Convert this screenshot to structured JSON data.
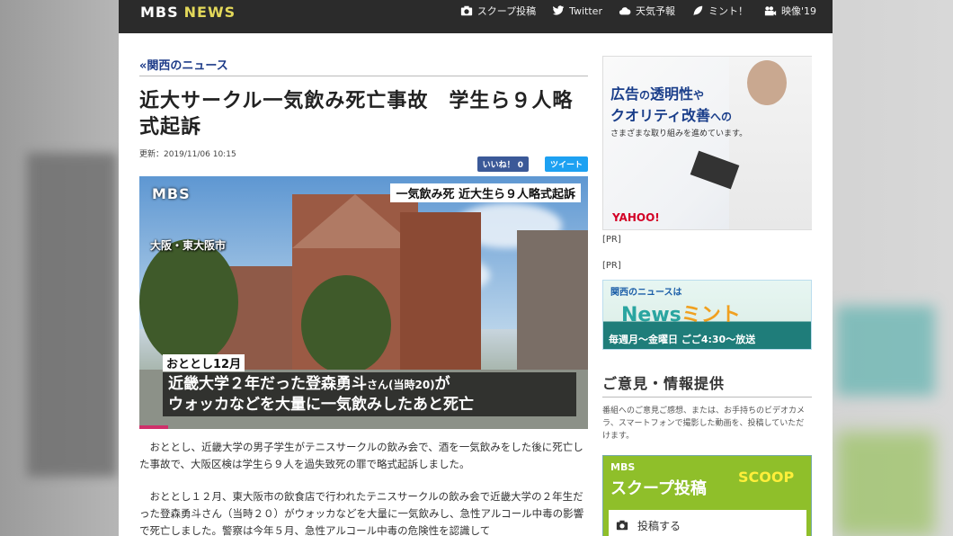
{
  "header": {
    "logo_mbs": "MBS",
    "logo_news": "NEWS",
    "nav": [
      {
        "label": "スクープ投稿",
        "icon": "camera-icon"
      },
      {
        "label": "Twitter",
        "icon": "twitter-icon"
      },
      {
        "label": "天気予報",
        "icon": "cloud-icon"
      },
      {
        "label": "ミント！",
        "icon": "leaf-icon"
      },
      {
        "label": "映像'19",
        "icon": "video-icon"
      }
    ]
  },
  "article": {
    "breadcrumb": "«関西のニュース",
    "title": "近大サークル一気飲み死亡事故　学生ら９人略式起訴",
    "updated": "更新：2019/11/06 10:15",
    "like_label": "いいね！ 0",
    "tweet_label": "ツイート",
    "video": {
      "logo": "MBS",
      "top_caption": "一気飲み死 近大生ら９人略式起訴",
      "place": "大阪・東大阪市",
      "when": "おととし12月",
      "subtitle_line1_a": "近畿大学２年だった登森勇斗",
      "subtitle_line1_b": "さん(当時20)",
      "subtitle_line1_c": "が",
      "subtitle_line2": "ウォッカなどを大量に一気飲みしたあと死亡"
    },
    "paragraphs": [
      "おととし、近畿大学の男子学生がテニスサークルの飲み会で、酒を一気飲みをした後に死亡した事故で、大阪区検は学生ら９人を過失致死の罪で略式起訴しました。",
      "おととし１２月、東大阪市の飲食店で行われたテニスサークルの飲み会で近畿大学の２年生だった登森勇斗さん（当時２０）がウォッカなどを大量に一気飲みし、急性アルコール中毒の影響で死亡しました。警察は今年５月、急性アルコール中毒の危険性を認識して"
    ]
  },
  "sidebar": {
    "ad1": {
      "line1_a": "広告",
      "line1_b": "の",
      "line1_c": "透明性",
      "line1_d": "や",
      "line2_a": "クオリティ改善",
      "line2_b": "への",
      "line3": "さまざまな取り組みを進めています。",
      "brand": "YAHOO!"
    },
    "pr1": "[PR]",
    "pr2": "[PR]",
    "ad2": {
      "top": "関西のニュースは",
      "logo_a": "News",
      "logo_b": "ミント",
      "bottom": "毎週月～金曜日 ごご4:30～放送"
    },
    "info_heading": "ご意見・情報提供",
    "info_text": "番組へのご意見ご感想、または、お手持ちのビデオカメラ、スマートフォンで撮影した動画を、投稿していただけます。",
    "ad3": {
      "mbs": "MBS",
      "title": "スクープ投稿",
      "scoop": "SCOOP",
      "post_label": "投稿する"
    }
  }
}
